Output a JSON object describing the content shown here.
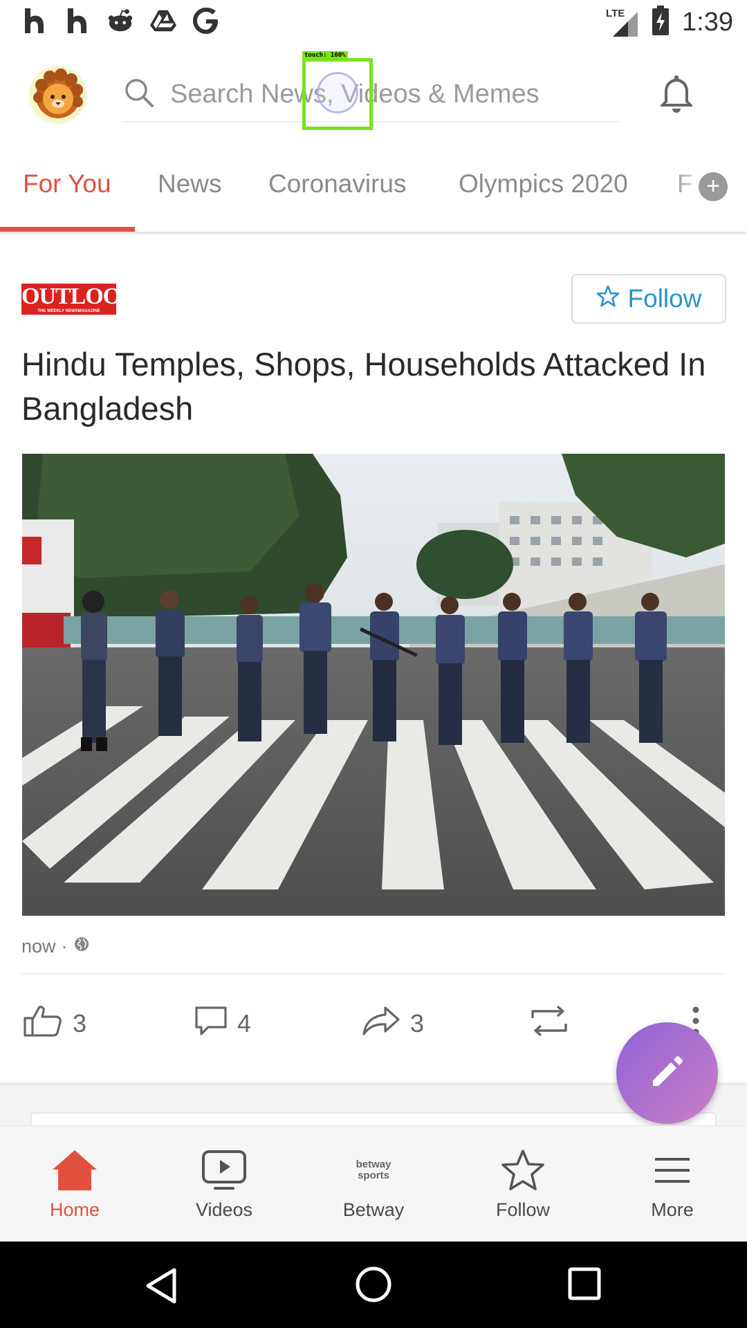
{
  "status_bar": {
    "icons": [
      "h-app-icon",
      "h-app-icon",
      "reddit-icon",
      "drive-icon",
      "google-icon"
    ],
    "network": "LTE",
    "time": "1:39"
  },
  "header": {
    "search_placeholder": "Search News, Videos & Memes",
    "avatar_icon": "lion-avatar-icon",
    "notification_icon": "bell-icon"
  },
  "touch_overlay": {
    "label": "touch: 100%"
  },
  "tabs": [
    {
      "label": "For You",
      "active": true
    },
    {
      "label": "News",
      "active": false
    },
    {
      "label": "Coronavirus",
      "active": false
    },
    {
      "label": "Olympics 2020",
      "active": false
    },
    {
      "label": "F",
      "active": false
    }
  ],
  "tabs_add_label": "+",
  "post": {
    "source": "OUTLOOK",
    "source_tagline": "THE WEEKLY NEWSMAGAZINE",
    "follow_label": "Follow",
    "headline": "Hindu Temples, Shops, Households Attacked In Bangladesh",
    "time": "now",
    "separator": "·",
    "visibility_icon": "globe-icon",
    "likes": "3",
    "comments": "4",
    "shares": "3"
  },
  "colors": {
    "accent": "#e4503f",
    "follow_blue": "#2793cc",
    "fab_gradient_start": "#8f62d8",
    "fab_gradient_end": "#c97fc4"
  },
  "bottom_nav": [
    {
      "label": "Home",
      "icon": "home-icon",
      "active": true
    },
    {
      "label": "Videos",
      "icon": "video-icon",
      "active": false
    },
    {
      "label": "Betway",
      "icon": "betway-icon",
      "active": false,
      "logo_text": "betway sports"
    },
    {
      "label": "Follow",
      "icon": "star-icon",
      "active": false
    },
    {
      "label": "More",
      "icon": "menu-icon",
      "active": false
    }
  ]
}
